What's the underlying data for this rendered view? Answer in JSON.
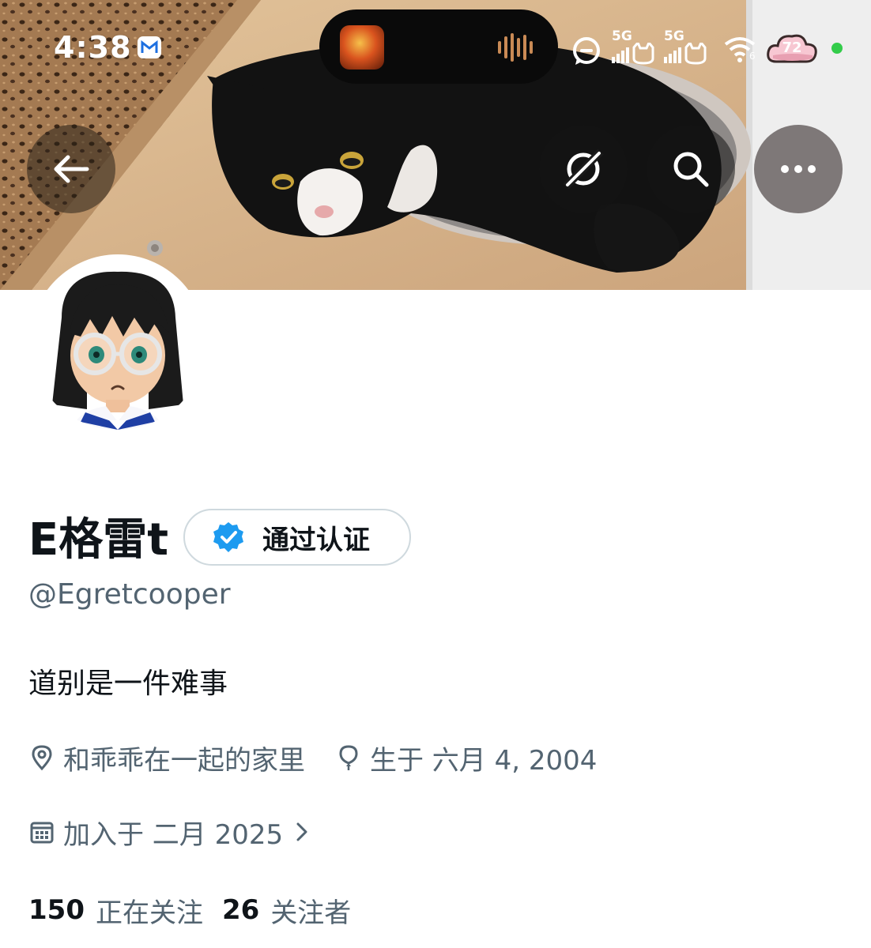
{
  "status_bar": {
    "time": "4:38",
    "network_1": "5G",
    "network_2": "5G",
    "wifi_sub": "6",
    "battery": "72"
  },
  "header": {
    "back_icon": "arrow-left-icon",
    "grok_icon": "grok-icon",
    "search_icon": "search-icon",
    "more_icon": "more-horizontal-icon"
  },
  "profile": {
    "display_name": "E格雷t",
    "verified_label": "通过认证",
    "handle": "@Egretcooper",
    "bio": "道别是一件难事",
    "location": "和乖乖在一起的家里",
    "birthday": "生于 六月 4, 2004",
    "joined": "加入于 二月 2025"
  },
  "stats": {
    "following_count": "150",
    "following_label": "正在关注",
    "followers_count": "26",
    "followers_label": "关注者"
  },
  "colors": {
    "verified_blue": "#1d9bf0",
    "secondary_text": "#536471",
    "primary_text": "#0f1419"
  }
}
